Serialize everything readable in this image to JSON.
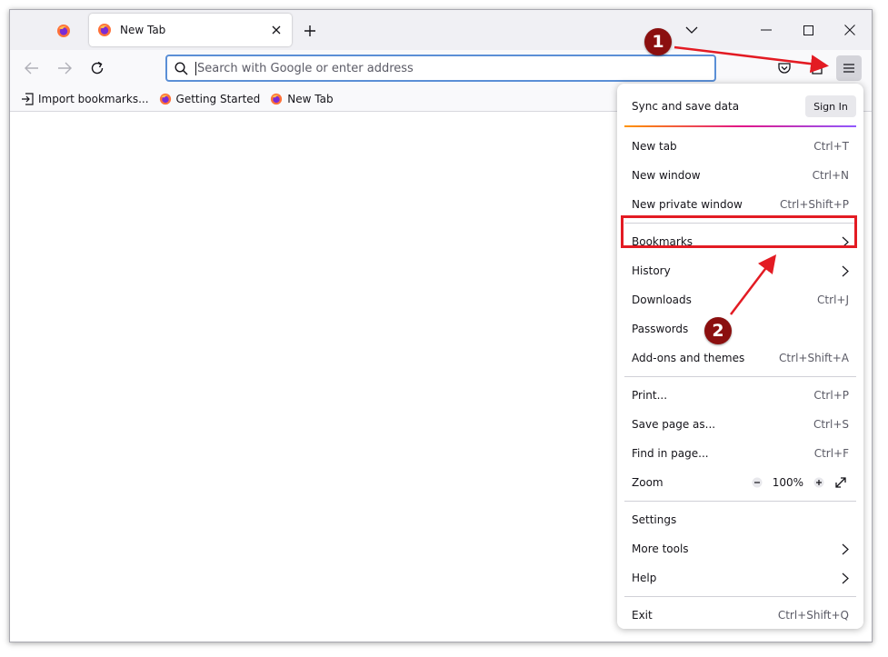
{
  "tabs": [
    {
      "title": "New Tab"
    }
  ],
  "urlbar": {
    "placeholder": "Search with Google or enter address"
  },
  "bookmarks_bar": [
    {
      "label": "Import bookmarks..."
    },
    {
      "label": "Getting Started"
    },
    {
      "label": "New Tab"
    }
  ],
  "menu": {
    "sync_label": "Sync and save data",
    "sign_in_label": "Sign In",
    "items": [
      {
        "label": "New tab",
        "shortcut": "Ctrl+T"
      },
      {
        "label": "New window",
        "shortcut": "Ctrl+N"
      },
      {
        "label": "New private window",
        "shortcut": "Ctrl+Shift+P"
      },
      {
        "label": "Bookmarks",
        "shortcut": ""
      },
      {
        "label": "History",
        "shortcut": ""
      },
      {
        "label": "Downloads",
        "shortcut": "Ctrl+J"
      },
      {
        "label": "Passwords",
        "shortcut": ""
      },
      {
        "label": "Add-ons and themes",
        "shortcut": "Ctrl+Shift+A"
      },
      {
        "label": "Print...",
        "shortcut": "Ctrl+P"
      },
      {
        "label": "Save page as...",
        "shortcut": "Ctrl+S"
      },
      {
        "label": "Find in page...",
        "shortcut": "Ctrl+F"
      },
      {
        "label": "Zoom",
        "shortcut": ""
      },
      {
        "label": "Settings",
        "shortcut": ""
      },
      {
        "label": "More tools",
        "shortcut": ""
      },
      {
        "label": "Help",
        "shortcut": ""
      },
      {
        "label": "Exit",
        "shortcut": "Ctrl+Shift+Q"
      }
    ],
    "zoom": {
      "minus": "−",
      "value": "100%",
      "plus": "+"
    }
  },
  "annotations": {
    "step1": "1",
    "step2": "2",
    "color": "#e31b23",
    "badge_color": "#8b0f0f"
  },
  "colors": {
    "accent": "#5b8fd6",
    "tabbar": "#f0f0f4",
    "toolbar": "#f9f9fb"
  },
  "icons": {
    "firefox": "firefox-icon",
    "close": "close-icon",
    "plus": "plus-icon",
    "chevron_down": "chevron-down-icon",
    "minimize": "minimize-icon",
    "maximize": "maximize-icon",
    "back": "back-arrow-icon",
    "forward": "forward-arrow-icon",
    "reload": "reload-icon",
    "search": "search-icon",
    "pocket": "pocket-icon",
    "extensions": "extensions-icon",
    "hamburger": "hamburger-menu-icon",
    "import": "import-icon",
    "chevron_right": "chevron-right-icon",
    "fullscreen": "fullscreen-icon"
  }
}
